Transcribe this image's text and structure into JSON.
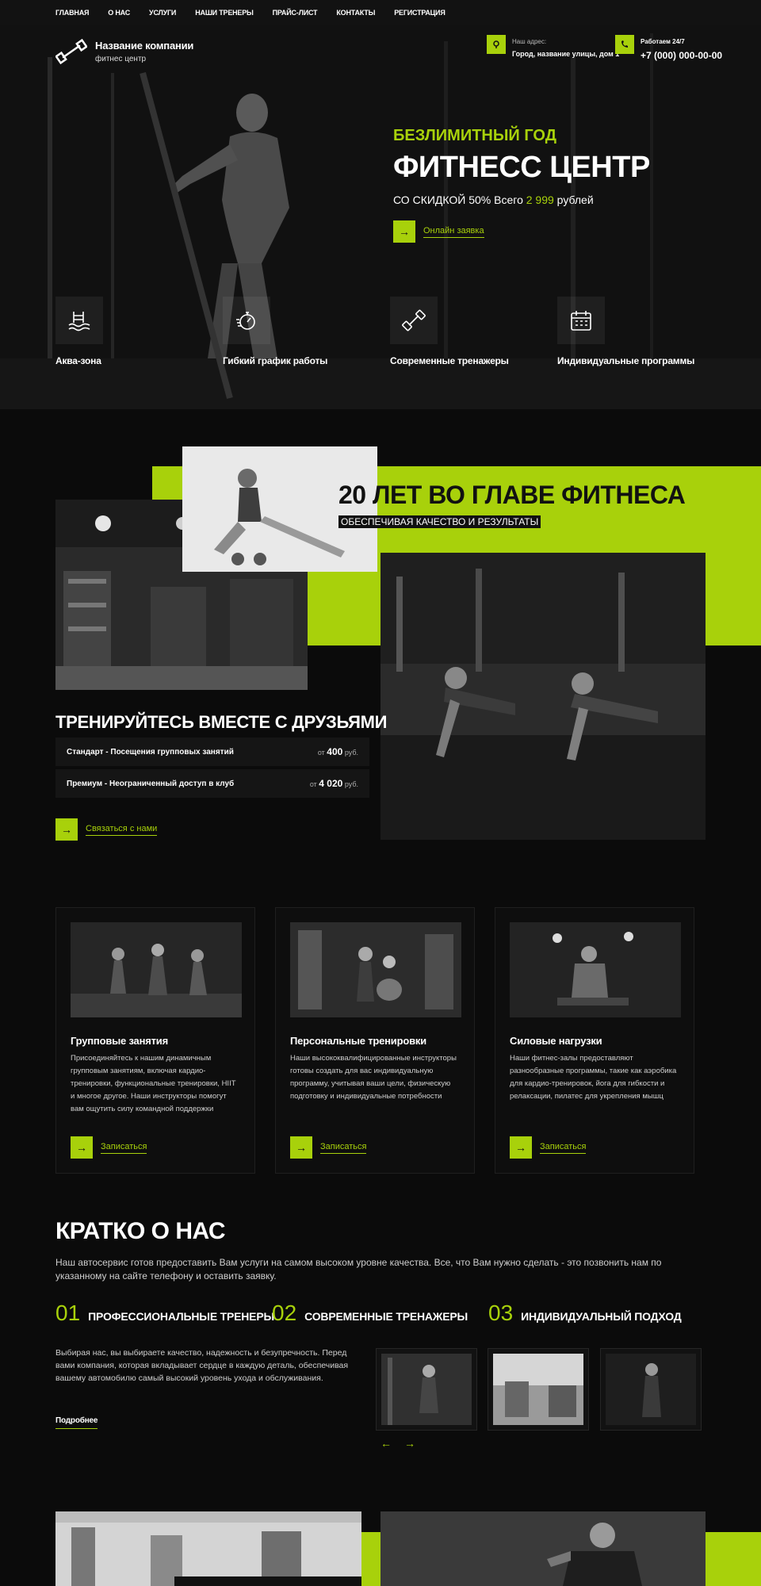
{
  "nav": [
    "ГЛАВНАЯ",
    "О НАС",
    "УСЛУГИ",
    "НАШИ ТРЕНЕРЫ",
    "ПРАЙС-ЛИСТ",
    "КОНТАКТЫ",
    "РЕГИСТРАЦИЯ"
  ],
  "brand": {
    "name": "Название компании",
    "sub": "фитнес центр"
  },
  "contacts": {
    "address_label": "Наш адрес:",
    "address": "Город, название улицы, дом 1",
    "hours_label": "Работаем 24/7",
    "phone": "+7 (000) 000-00-00"
  },
  "hero": {
    "kicker": "БЕЗЛИМИТНЫЙ ГОД",
    "title": "ФИТНЕСС ЦЕНТР",
    "offer_prefix": "СО СКИДКОЙ 50% Всего ",
    "offer_price": "2 999",
    "offer_suffix": " рублей",
    "cta": "Онлайн заявка"
  },
  "features": [
    {
      "label": "Аква-зона",
      "icon": "pool-icon"
    },
    {
      "label": "Гибкий график работы",
      "icon": "stopwatch-icon"
    },
    {
      "label": "Современные тренажеры",
      "icon": "dumbbell-icon"
    },
    {
      "label": "Индивидуальные программы",
      "icon": "calendar-icon"
    }
  ],
  "about": {
    "title": "20 ЛЕТ ВО ГЛАВЕ ФИТНЕСА",
    "subtitle": "ОБЕСПЕЧИВАЯ КАЧЕСТВО И РЕЗУЛЬТАТЫ",
    "train_title": "ТРЕНИРУЙТЕСЬ ВМЕСТЕ С ДРУЗЬЯМИ",
    "plans": [
      {
        "name": "Стандарт - Посещения групповых занятий",
        "from": "от",
        "price": "400",
        "unit": "руб."
      },
      {
        "name": "Премиум - Неограниченный доступ в клуб",
        "from": "от",
        "price": "4 020",
        "unit": "руб."
      }
    ],
    "cta": "Связаться с нами"
  },
  "services": [
    {
      "title": "Групповые занятия",
      "desc": "Присоединяйтесь к нашим динамичным групповым занятиям, включая кардио-тренировки, функциональные тренировки, HIIT и многое другое. Наши инструкторы помогут вам ощутить силу командной поддержки",
      "cta": "Записаться"
    },
    {
      "title": "Персональные тренировки",
      "desc": "Наши высококвалифицированные инструкторы готовы создать для вас индивидуальную программу, учитывая ваши цели, физическую подготовку и индивидуальные потребности",
      "cta": "Записаться"
    },
    {
      "title": "Силовые нагрузки",
      "desc": "Наши фитнес-залы предоставляют разнообразные программы, такие как аэробика для кардио-тренировок, йога для гибкости и релаксации, пилатес для укрепления мышц",
      "cta": "Записаться"
    }
  ],
  "brief": {
    "title": "КРАТКО О НАС",
    "desc": "Наш автосервис готов предоставить Вам услуги на самом высоком уровне качества. Все, что Вам нужно сделать - это позвонить нам по указанному на сайте телефону и оставить заявку.",
    "points": [
      {
        "num": "01",
        "label": "ПРОФЕССИОНАЛЬНЫЕ ТРЕНЕРЫ"
      },
      {
        "num": "02",
        "label": "СОВРЕМЕННЫЕ ТРЕНАЖЕРЫ"
      },
      {
        "num": "03",
        "label": "ИНДИВИДУАЛЬНЫЙ ПОДХОД"
      }
    ],
    "text": "Выбирая нас, вы выбираете качество, надежность и безупречность. Перед вами компания, которая вкладывает сердце в каждую деталь, обеспечивая вашему автомобилю самый высокий уровень ухода и обслуживания.",
    "more": "Подробнее",
    "prev": "←",
    "next": "→"
  },
  "colors": {
    "accent": "#a8d10b",
    "background": "#0b0b0b"
  }
}
